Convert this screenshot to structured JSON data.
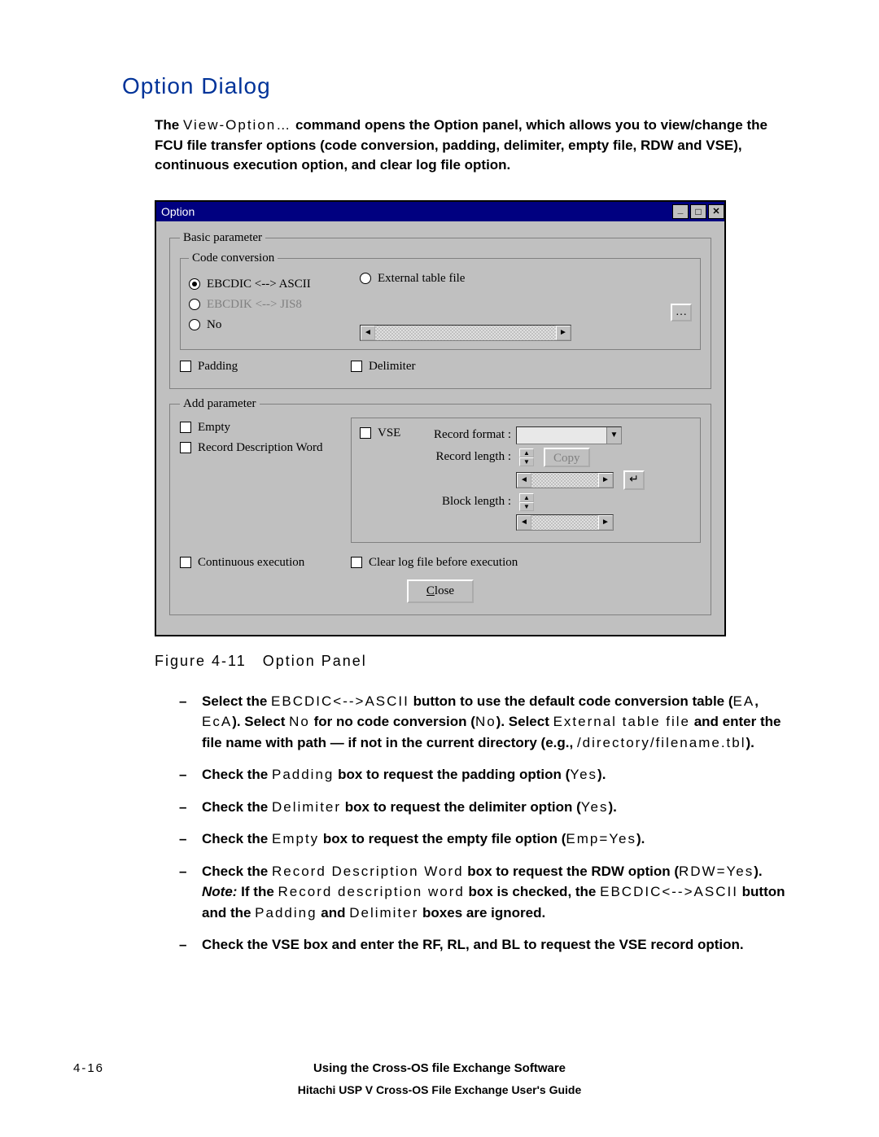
{
  "heading": "Option Dialog",
  "intro": {
    "pre": "The ",
    "cmd": "View-Option…",
    "post": " command opens the Option panel, which allows you to view/change the FCU file transfer options (code conversion, padding, delimiter, empty file, RDW and VSE), continuous execution option, and clear log file option."
  },
  "dialog": {
    "title": "Option",
    "basic_legend": "Basic parameter",
    "code_legend": "Code conversion",
    "radios": {
      "ebcdic_ascii": "EBCDIC <--> ASCII",
      "ebcdik_jis8": "EBCDIK <--> JIS8",
      "no": "No",
      "external": "External table file"
    },
    "padding": "Padding",
    "delimiter": "Delimiter",
    "add_legend": "Add parameter",
    "empty": "Empty",
    "rdw": "Record Description Word",
    "vse": "VSE",
    "rf": "Record format :",
    "rl": "Record length :",
    "bl": "Block length :",
    "copy": "Copy",
    "cont": "Continuous execution",
    "clear": "Clear log file before execution",
    "close": "Close"
  },
  "figcap": "Figure 4-11 Option Panel",
  "bullets": [
    {
      "parts": [
        {
          "b": true,
          "t": "Select the "
        },
        {
          "mono": true,
          "t": "EBCDIC<-->ASCII"
        },
        {
          "b": true,
          "t": " button to use the default code conversion table ("
        },
        {
          "mono": true,
          "t": "EA"
        },
        {
          "b": true,
          "t": ", "
        },
        {
          "mono": true,
          "t": "EcA"
        },
        {
          "b": true,
          "t": "). Select "
        },
        {
          "mono": true,
          "t": "No"
        },
        {
          "b": true,
          "t": " for no code conversion ("
        },
        {
          "mono": true,
          "t": "No"
        },
        {
          "b": true,
          "t": "). Select "
        },
        {
          "mono": true,
          "t": "External table file"
        },
        {
          "b": true,
          "t": " and enter the file name with path — if not in the current directory (e.g., "
        },
        {
          "mono": true,
          "t": "/directory/filename.tbl"
        },
        {
          "b": true,
          "t": ")."
        }
      ]
    },
    {
      "parts": [
        {
          "b": true,
          "t": "Check the "
        },
        {
          "mono": true,
          "t": "Padding"
        },
        {
          "b": true,
          "t": " box to request the padding option ("
        },
        {
          "mono": true,
          "t": "Yes"
        },
        {
          "b": true,
          "t": ")."
        }
      ]
    },
    {
      "parts": [
        {
          "b": true,
          "t": "Check the "
        },
        {
          "mono": true,
          "t": "Delimiter"
        },
        {
          "b": true,
          "t": " box to request the delimiter option ("
        },
        {
          "mono": true,
          "t": "Yes"
        },
        {
          "b": true,
          "t": ")."
        }
      ]
    },
    {
      "parts": [
        {
          "b": true,
          "t": "Check the "
        },
        {
          "mono": true,
          "t": "Empty"
        },
        {
          "b": true,
          "t": " box to request the empty file option ("
        },
        {
          "mono": true,
          "t": "Emp=Yes"
        },
        {
          "b": true,
          "t": ")."
        }
      ]
    },
    {
      "parts": [
        {
          "b": true,
          "t": "Check the "
        },
        {
          "mono": true,
          "t": "Record Description Word"
        },
        {
          "b": true,
          "t": " box to request the RDW option ("
        },
        {
          "mono": true,
          "t": "RDW=Yes"
        },
        {
          "b": true,
          "t": "). "
        },
        {
          "i": true,
          "t": "Note:"
        },
        {
          "b": true,
          "t": " If the "
        },
        {
          "mono": true,
          "t": "Record description word"
        },
        {
          "b": true,
          "t": " box is checked, the "
        },
        {
          "mono": true,
          "t": "EBCDIC<-->ASCII"
        },
        {
          "b": true,
          "t": " button and the "
        },
        {
          "mono": true,
          "t": "Padding"
        },
        {
          "b": true,
          "t": " and "
        },
        {
          "mono": true,
          "t": "Delimiter"
        },
        {
          "b": true,
          "t": " boxes are ignored."
        }
      ]
    },
    {
      "parts": [
        {
          "b": true,
          "t": "Check the VSE box and enter the RF, RL, and BL to request the VSE record option."
        }
      ]
    }
  ],
  "footer": {
    "pnum": "4-16",
    "line1": "Using the Cross-OS file Exchange Software",
    "line2": "Hitachi USP V Cross-OS File Exchange User's Guide"
  }
}
